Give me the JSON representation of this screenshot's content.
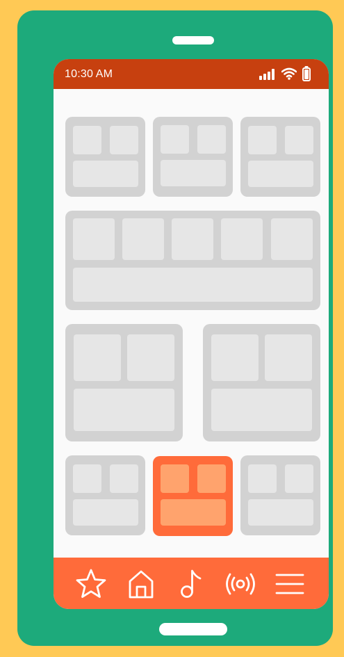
{
  "colors": {
    "background": "#FFC955",
    "phone_body": "#1DAA7B",
    "status_bar": "#C7400F",
    "nav_bar": "#FF6B3A",
    "tile": "#D2D2D2",
    "tile_cell": "#E6E6E6",
    "tile_active": "#FF6B3A",
    "tile_active_cell": "#FFA36D"
  },
  "status_bar": {
    "time": "10:30 AM",
    "icons": [
      "signal-icon",
      "wifi-icon",
      "battery-icon"
    ]
  },
  "grid": {
    "rows": [
      {
        "tiles": [
          {
            "state": "default"
          },
          {
            "state": "default"
          },
          {
            "state": "default"
          }
        ]
      },
      {
        "tiles": [
          {
            "state": "default"
          }
        ]
      },
      {
        "tiles": [
          {
            "state": "default"
          },
          {
            "state": "default"
          }
        ]
      },
      {
        "tiles": [
          {
            "state": "default"
          },
          {
            "state": "selected"
          },
          {
            "state": "default"
          }
        ]
      }
    ]
  },
  "nav": {
    "items": [
      {
        "icon": "star-icon"
      },
      {
        "icon": "home-icon"
      },
      {
        "icon": "music-note-icon"
      },
      {
        "icon": "broadcast-icon"
      },
      {
        "icon": "menu-icon"
      }
    ]
  }
}
